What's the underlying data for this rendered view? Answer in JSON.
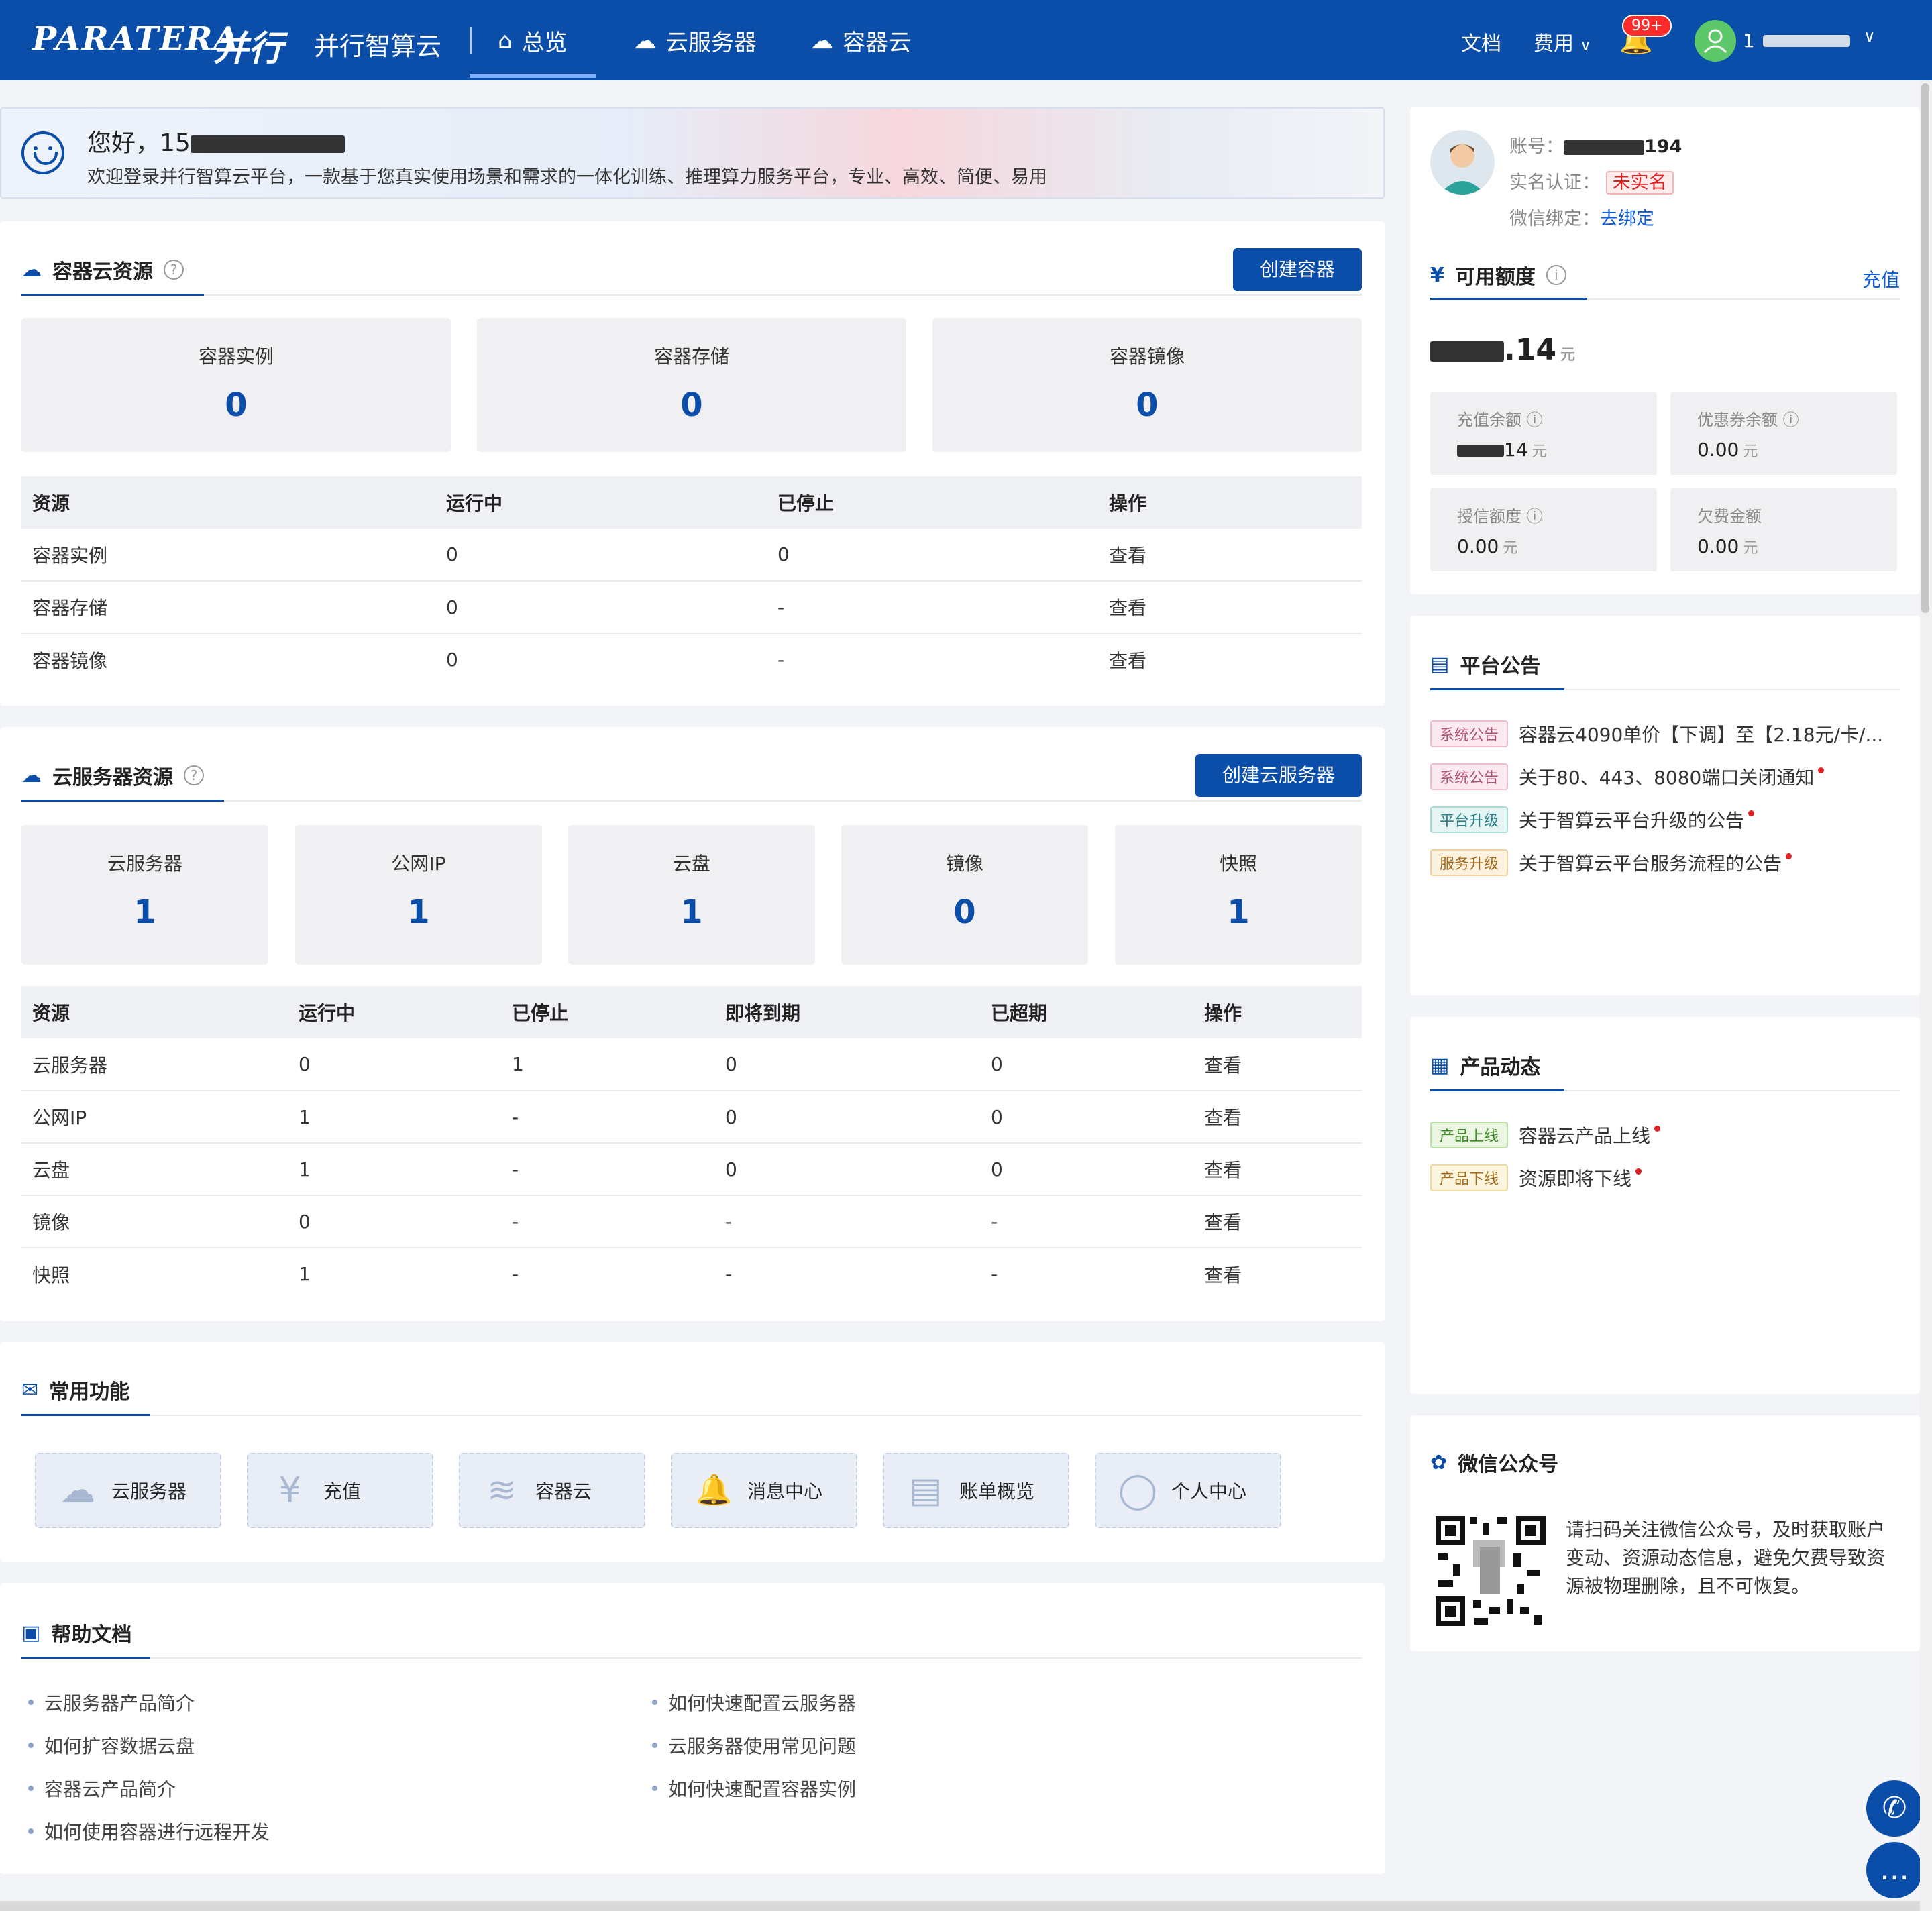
{
  "topbar": {
    "logo_text": "PARATERA",
    "logo_cn": "并行",
    "brand": "并行智算云",
    "nav": [
      {
        "label": "总览",
        "icon": "home-icon"
      },
      {
        "label": "云服务器",
        "icon": "cloud-server-icon"
      },
      {
        "label": "容器云",
        "icon": "container-cloud-icon"
      }
    ],
    "docs": "文档",
    "fees": "费用",
    "bell_badge": "99+",
    "user_prefix": "1"
  },
  "hello": {
    "greeting": "您好，15",
    "subtitle": "欢迎登录并行智算云平台，一款基于您真实使用场景和需求的一体化训练、推理算力服务平台，专业、高效、简便、易用"
  },
  "container": {
    "title": "容器云资源",
    "create_btn": "创建容器",
    "stats": [
      {
        "label": "容器实例",
        "value": "0"
      },
      {
        "label": "容器存储",
        "value": "0"
      },
      {
        "label": "容器镜像",
        "value": "0"
      }
    ],
    "headers": [
      "资源",
      "运行中",
      "已停止",
      "操作"
    ],
    "rows": [
      {
        "name": "容器实例",
        "running": "0",
        "stopped": "0",
        "action": "查看"
      },
      {
        "name": "容器存储",
        "running": "0",
        "stopped": "-",
        "action": "查看"
      },
      {
        "name": "容器镜像",
        "running": "0",
        "stopped": "-",
        "action": "查看"
      }
    ]
  },
  "server": {
    "title": "云服务器资源",
    "create_btn": "创建云服务器",
    "stats": [
      {
        "label": "云服务器",
        "value": "1"
      },
      {
        "label": "公网IP",
        "value": "1"
      },
      {
        "label": "云盘",
        "value": "1"
      },
      {
        "label": "镜像",
        "value": "0"
      },
      {
        "label": "快照",
        "value": "1"
      }
    ],
    "headers": [
      "资源",
      "运行中",
      "已停止",
      "即将到期",
      "已超期",
      "操作"
    ],
    "rows": [
      {
        "name": "云服务器",
        "running": "0",
        "stopped": "1",
        "expiring": "0",
        "expired": "0",
        "action": "查看"
      },
      {
        "name": "公网IP",
        "running": "1",
        "stopped": "-",
        "expiring": "0",
        "expired": "0",
        "action": "查看"
      },
      {
        "name": "云盘",
        "running": "1",
        "stopped": "-",
        "expiring": "0",
        "expired": "0",
        "action": "查看"
      },
      {
        "name": "镜像",
        "running": "0",
        "stopped": "-",
        "expiring": "-",
        "expired": "-",
        "action": "查看"
      },
      {
        "name": "快照",
        "running": "1",
        "stopped": "-",
        "expiring": "-",
        "expired": "-",
        "action": "查看"
      }
    ]
  },
  "functions": {
    "title": "常用功能",
    "items": [
      {
        "label": "云服务器",
        "icon": "cloud-server-icon",
        "glyph": "☁"
      },
      {
        "label": "充值",
        "icon": "recharge-icon",
        "glyph": "¥"
      },
      {
        "label": "容器云",
        "icon": "container-icon",
        "glyph": "≋"
      },
      {
        "label": "消息中心",
        "icon": "bell-icon",
        "glyph": "🔔"
      },
      {
        "label": "账单概览",
        "icon": "bill-icon",
        "glyph": "▤"
      },
      {
        "label": "个人中心",
        "icon": "user-icon",
        "glyph": "◯"
      }
    ]
  },
  "docs": {
    "title": "帮助文档",
    "left": [
      "云服务器产品简介",
      "如何扩容数据云盘",
      "容器云产品简介",
      "如何使用容器进行远程开发"
    ],
    "right": [
      "如何快速配置云服务器",
      "云服务器使用常见问题",
      "如何快速配置容器实例"
    ]
  },
  "account": {
    "account_label": "账号：",
    "account_suffix": "194",
    "realname_label": "实名认证：",
    "realname_status": "未实名",
    "wechat_label": "微信绑定：",
    "wechat_action": "去绑定"
  },
  "balance": {
    "title": "可用额度",
    "recharge": "充值",
    "total_suffix": ".14",
    "unit": "元",
    "boxes": [
      {
        "label": "充值余额",
        "value": "14"
      },
      {
        "label": "优惠券余额",
        "value": "0.00"
      },
      {
        "label": "授信额度",
        "value": "0.00"
      },
      {
        "label": "欠费金额",
        "value": "0.00"
      }
    ]
  },
  "notices": {
    "title": "平台公告",
    "items": [
      {
        "tag": "系统公告",
        "text": "容器云4090单价【下调】至【2.18元/卡/..."
      },
      {
        "tag": "系统公告",
        "text": "关于80、443、8080端口关闭通知"
      },
      {
        "tag": "平台升级",
        "text": "关于智算云平台升级的公告"
      },
      {
        "tag": "服务升级",
        "text": "关于智算云平台服务流程的公告"
      }
    ]
  },
  "products": {
    "title": "产品动态",
    "items": [
      {
        "tag": "产品上线",
        "text": "容器云产品上线"
      },
      {
        "tag": "产品下线",
        "text": "资源即将下线"
      }
    ]
  },
  "wechat": {
    "title": "微信公众号",
    "text": "请扫码关注微信公众号，及时获取账户变动、资源动态信息，避免欠费导致资源被物理删除，且不可恢复。"
  },
  "colors": {
    "brand": "#0a4eaa",
    "running": "#198a1f",
    "expiring": "#e99b0e",
    "expired": "#e02020",
    "link": "#0a5bd5"
  }
}
